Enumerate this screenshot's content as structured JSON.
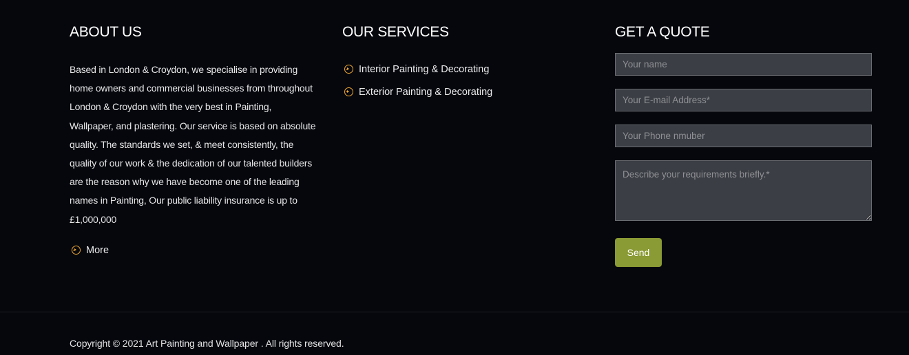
{
  "about": {
    "heading": "ABOUT US",
    "text": "Based in London & Croydon, we specialise in providing home owners and commercial businesses from throughout London & Croydon with the very best in Painting, Wallpaper, and plastering. Our service is based on absolute quality. The standards we set, & meet consistently, the quality of our work & the dedication of our talented builders are the reason why we have become one of the leading names in Painting, Our public liability insurance is up to £1,000,000",
    "more_label": "More",
    "more_icon": "circle-arrow-right-icon"
  },
  "services": {
    "heading": "OUR SERVICES",
    "items": [
      {
        "label": "Interior Painting & Decorating",
        "icon": "circle-arrow-right-icon"
      },
      {
        "label": "Exterior Painting & Decorating",
        "icon": "circle-arrow-right-icon"
      }
    ]
  },
  "quote": {
    "heading": "GET A QUOTE",
    "name_placeholder": "Your name",
    "email_placeholder": "Your E-mail Address*",
    "phone_placeholder": "Your Phone nmuber",
    "message_placeholder": "Describe your requirements briefly.*",
    "send_label": "Send"
  },
  "footer": {
    "copyright": "Copyright © 2021 Art Painting and Wallpaper . All rights reserved."
  },
  "colors": {
    "background": "#05070d",
    "accent_icon": "#f0a830",
    "send_button": "#8a9a34",
    "field_background": "#3b3e44"
  }
}
